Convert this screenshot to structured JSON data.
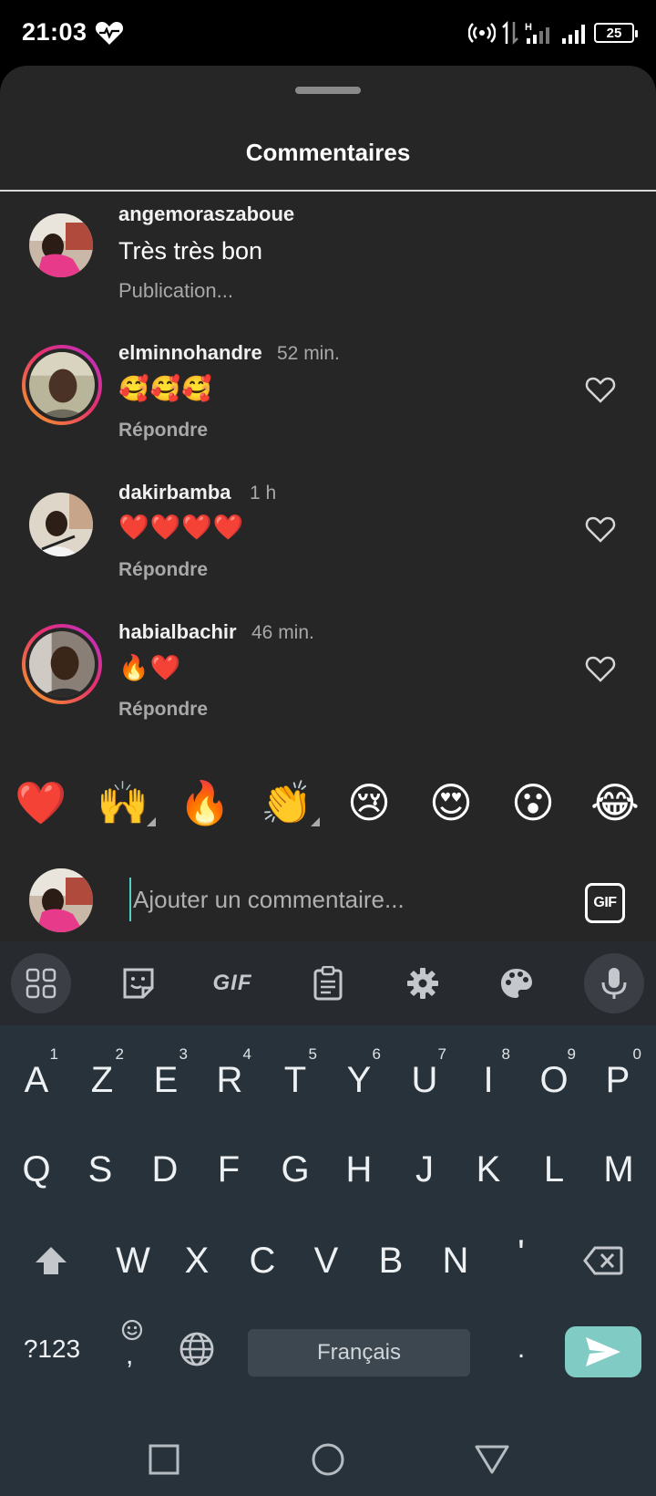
{
  "status": {
    "time": "21:03",
    "battery": "25"
  },
  "sheet": {
    "title": "Commentaires"
  },
  "comments": [
    {
      "username": "angemoraszaboue",
      "text": "Très très bon",
      "action": "Publication..."
    },
    {
      "username": "elminnohandre",
      "time": "52 min.",
      "text": "🥰🥰🥰",
      "action": "Répondre"
    },
    {
      "username": "dakirbamba",
      "time": "1 h",
      "text": "❤️❤️❤️❤️",
      "action": "Répondre"
    },
    {
      "username": "habialbachir",
      "time": "46 min.",
      "text": "🔥❤️",
      "action": "Répondre"
    }
  ],
  "reactions": [
    "❤️",
    "🙌",
    "🔥",
    "👏",
    "😢",
    "😍",
    "😮",
    "😂"
  ],
  "composer": {
    "placeholder": "Ajouter un commentaire...",
    "gif_label": "GIF"
  },
  "keyboard": {
    "toolbar_gif": "GIF",
    "row1": [
      "A",
      "Z",
      "E",
      "R",
      "T",
      "Y",
      "U",
      "I",
      "O",
      "P"
    ],
    "row1_nums": [
      "1",
      "2",
      "3",
      "4",
      "5",
      "6",
      "7",
      "8",
      "9",
      "0"
    ],
    "row2": [
      "Q",
      "S",
      "D",
      "F",
      "G",
      "H",
      "J",
      "K",
      "L",
      "M"
    ],
    "row3": [
      "W",
      "X",
      "C",
      "V",
      "B",
      "N",
      "'"
    ],
    "symbols_key": "?123",
    "emoji_key_sub": ",",
    "space_label": "Français",
    "period_key": "."
  }
}
